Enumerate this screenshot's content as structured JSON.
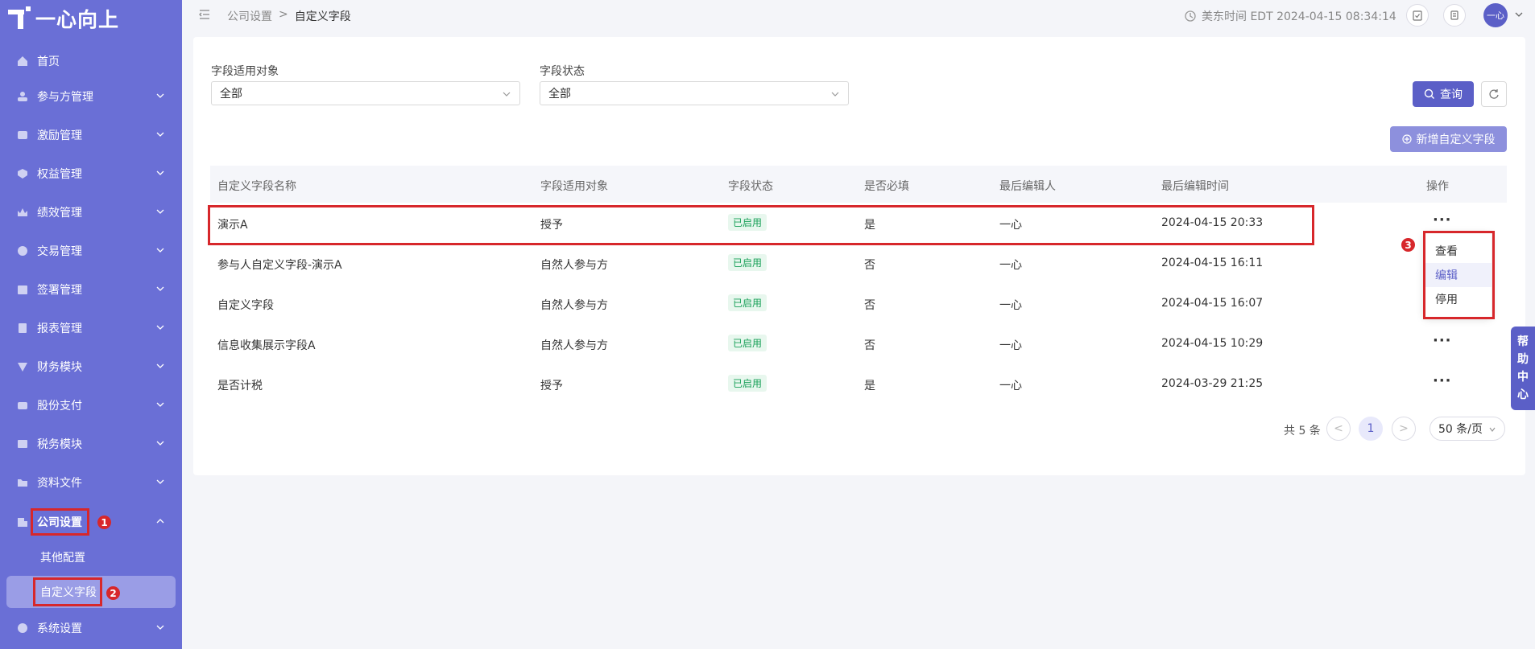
{
  "app": {
    "logo_text": "一心向上"
  },
  "sidebar": {
    "items": [
      {
        "label": "首页",
        "icon": "home-icon"
      },
      {
        "label": "参与方管理",
        "icon": "people-icon"
      },
      {
        "label": "激励管理",
        "icon": "incentive-icon"
      },
      {
        "label": "权益管理",
        "icon": "equity-icon"
      },
      {
        "label": "绩效管理",
        "icon": "performance-icon"
      },
      {
        "label": "交易管理",
        "icon": "trade-icon"
      },
      {
        "label": "签署管理",
        "icon": "sign-icon"
      },
      {
        "label": "报表管理",
        "icon": "report-icon"
      },
      {
        "label": "财务模块",
        "icon": "finance-icon"
      },
      {
        "label": "股份支付",
        "icon": "share-payment-icon"
      },
      {
        "label": "税务模块",
        "icon": "tax-icon"
      },
      {
        "label": "资料文件",
        "icon": "folder-icon"
      },
      {
        "label": "公司设置",
        "icon": "company-icon"
      },
      {
        "label": "系统设置",
        "icon": "system-icon"
      }
    ],
    "sub_items": [
      {
        "label": "其他配置"
      },
      {
        "label": "自定义字段"
      }
    ],
    "callouts": [
      "1",
      "2"
    ]
  },
  "header": {
    "breadcrumb": [
      "公司设置",
      ">",
      "自定义字段"
    ],
    "time": "美东时间 EDT 2024-04-15 08:34:14",
    "avatar": "一心"
  },
  "filters": {
    "object_label": "字段适用对象",
    "object_value": "全部",
    "status_label": "字段状态",
    "status_value": "全部",
    "query_label": "查询",
    "add_label": "新增自定义字段"
  },
  "table": {
    "columns": [
      "自定义字段名称",
      "字段适用对象",
      "字段状态",
      "是否必填",
      "最后编辑人",
      "最后编辑时间",
      "操作"
    ],
    "rows": [
      {
        "name": "演示A",
        "object": "授予",
        "status": "已启用",
        "required": "是",
        "editor": "一心",
        "time": "2024-04-15 20:33"
      },
      {
        "name": "参与人自定义字段-演示A",
        "object": "自然人参与方",
        "status": "已启用",
        "required": "否",
        "editor": "一心",
        "time": "2024-04-15 16:11"
      },
      {
        "name": "自定义字段",
        "object": "自然人参与方",
        "status": "已启用",
        "required": "否",
        "editor": "一心",
        "time": "2024-04-15 16:07"
      },
      {
        "name": "信息收集展示字段A",
        "object": "自然人参与方",
        "status": "已启用",
        "required": "否",
        "editor": "一心",
        "time": "2024-04-15 10:29"
      },
      {
        "name": "是否计税",
        "object": "授予",
        "status": "已启用",
        "required": "是",
        "editor": "一心",
        "time": "2024-03-29 21:25"
      }
    ],
    "more": "···"
  },
  "dropdown": {
    "items": [
      "查看",
      "编辑",
      "停用"
    ],
    "callout": "3"
  },
  "pagination": {
    "total": "共 5 条",
    "current": "1",
    "prev": "<",
    "next": ">",
    "page_size": "50 条/页"
  },
  "help": {
    "chars": [
      "帮",
      "助",
      "中",
      "心"
    ]
  },
  "colors": {
    "sidebar": "#6a6fd6",
    "primary": "#5b5fc7",
    "highlight": "#d7272b",
    "tag_green": "#18a058"
  }
}
